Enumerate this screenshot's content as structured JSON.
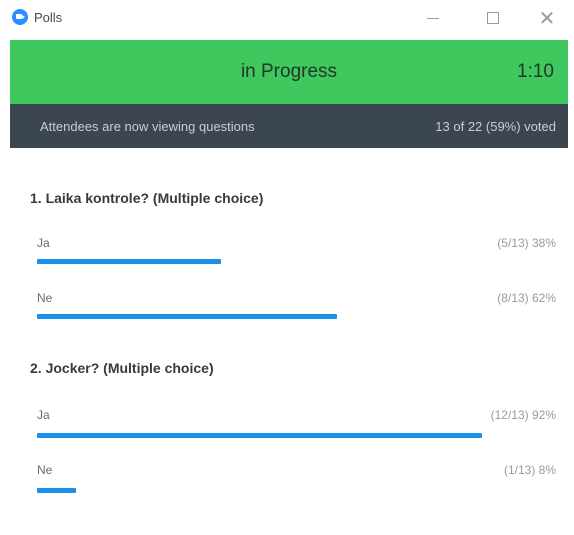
{
  "window": {
    "title": "Polls",
    "minimize_label": "",
    "close_glyph": "✕"
  },
  "status": {
    "text": "in Progress",
    "timer": "1:10",
    "bar_color": "#3ec85e"
  },
  "info": {
    "left": "Attendees are now viewing questions",
    "right": "13 of 22 (59%) voted"
  },
  "questions": [
    {
      "title": "1. Laika kontrole? (Multiple choice)",
      "answers": [
        {
          "label": "Ja",
          "stat": "(5/13) 38%",
          "fraction": 0.38
        },
        {
          "label": "Ne",
          "stat": "(8/13) 62%",
          "fraction": 0.62
        }
      ]
    },
    {
      "title": "2. Jocker? (Multiple choice)",
      "answers": [
        {
          "label": "Ja",
          "stat": "(12/13) 92%",
          "fraction": 0.92
        },
        {
          "label": "Ne",
          "stat": "(1/13) 8%",
          "fraction": 0.08
        }
      ]
    }
  ],
  "accent_color": "#1a90e8"
}
